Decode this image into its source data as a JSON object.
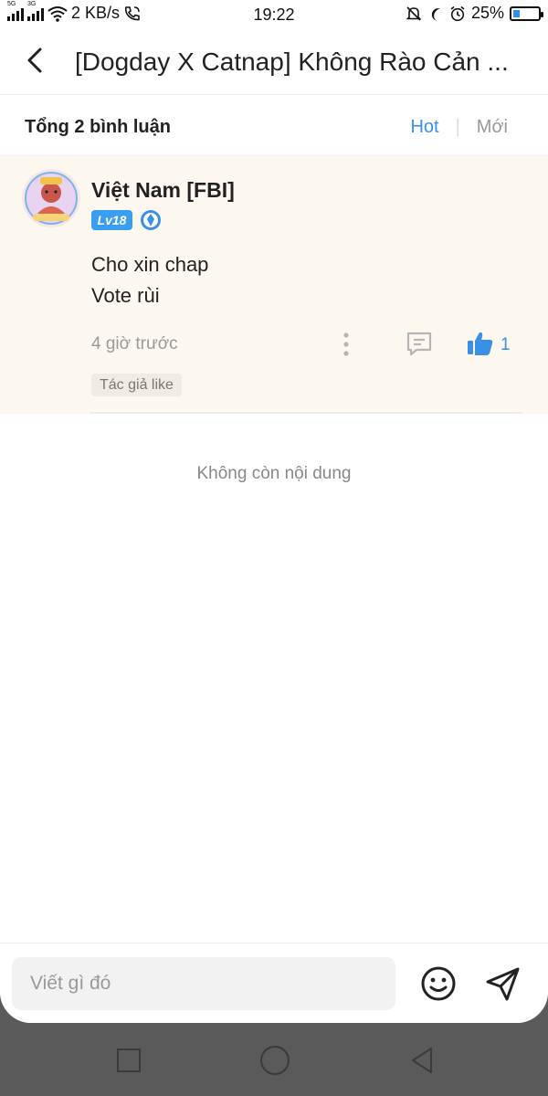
{
  "status_bar": {
    "signal1_label": "5G",
    "signal2_label": "3G",
    "speed": "2 KB/s",
    "time": "19:22",
    "battery": "25%",
    "battery_level": 0.25,
    "icons": [
      "signal-icon",
      "wifi-icon",
      "call-icon",
      "mute-bell-icon",
      "moon-icon",
      "alarm-icon",
      "battery-icon"
    ]
  },
  "header": {
    "title": "[Dogday X Catnap] Không Rào Cản ..."
  },
  "comments_header": {
    "count_label": "Tổng 2 bình luận",
    "sort_hot": "Hot",
    "sort_new": "Mới",
    "sort_separator": "|"
  },
  "comment": {
    "username": "Việt Nam [FBI]",
    "level": "Lv18",
    "lines": [
      "Cho xin chap",
      "Vote rùi"
    ],
    "time": "4 giờ trước",
    "likes": "1",
    "author_tag": "Tác giả like"
  },
  "end_message": "Không còn nội dung",
  "input": {
    "placeholder": "Viết gì đó"
  },
  "colors": {
    "accent": "#3a8fe6",
    "comment_bg": "#fdf8ef",
    "level_badge": "#3a9ef0"
  }
}
